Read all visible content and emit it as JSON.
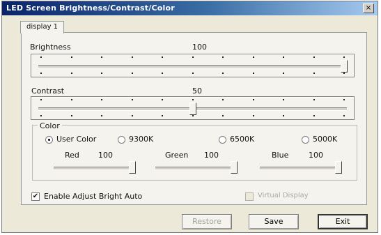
{
  "window": {
    "title": "LED Screen Brightness/Contrast/Color",
    "close_glyph": "×"
  },
  "tabs": [
    {
      "label": "display 1",
      "selected": true
    }
  ],
  "brightness": {
    "label": "Brightness",
    "value": "100",
    "level": 1.0
  },
  "contrast": {
    "label": "Contrast",
    "value": "50",
    "level": 0.5
  },
  "color": {
    "group_label": "Color",
    "options": [
      {
        "label": "User Color",
        "selected": true
      },
      {
        "label": "9300K",
        "selected": false
      },
      {
        "label": "6500K",
        "selected": false
      },
      {
        "label": "5000K",
        "selected": false
      }
    ],
    "channels": [
      {
        "label": "Red",
        "value": "100",
        "level": 1.0
      },
      {
        "label": "Green",
        "value": "100",
        "level": 1.0
      },
      {
        "label": "Blue",
        "value": "100",
        "level": 1.0
      }
    ]
  },
  "enable_auto": {
    "label": "Enable Adjust Bright Auto",
    "checked": true,
    "check_glyph": "✔"
  },
  "virtual_display": {
    "label": "Virtual Display",
    "checked": false,
    "enabled": false
  },
  "buttons": {
    "restore": "Restore",
    "save": "Save",
    "exit": "Exit"
  }
}
